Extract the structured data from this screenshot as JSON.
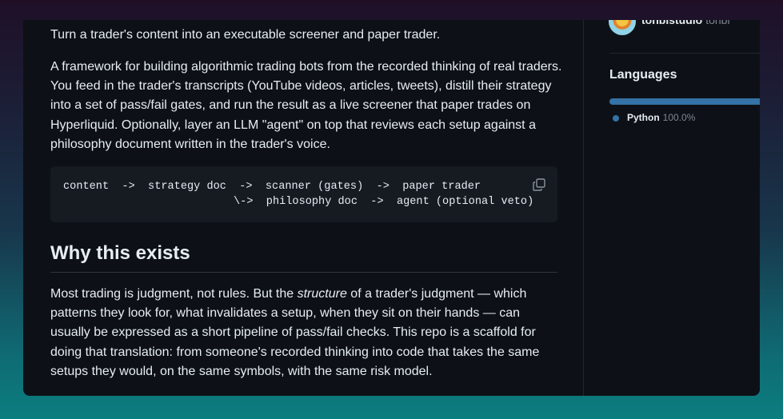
{
  "readme": {
    "tagline": "Turn a trader's content into an executable screener and paper trader.",
    "intro": "A framework for building algorithmic trading bots from the recorded thinking of real traders. You feed in the trader's transcripts (YouTube videos, articles, tweets), distill their strategy into a set of pass/fail gates, and run the result as a live screener that paper trades on Hyperliquid. Optionally, layer an LLM \"agent\" on top that reviews each setup against a philosophy document written in the trader's voice.",
    "code": {
      "line1": "content  ->  strategy doc  ->  scanner (gates)  ->  paper trader",
      "line2": "\\->  philosophy doc  ->  agent (optional veto)",
      "copy_icon": "copy-icon"
    },
    "section_heading": "Why this exists",
    "body": {
      "before": "Most trading is judgment, not rules. But the ",
      "emphasis": "structure",
      "after": " of a trader's judgment — which patterns they look for, what invalidates a setup, when they sit on their hands — can usually be expressed as a short pipeline of pass/fail checks. This repo is a scaffold for doing that translation: from someone's recorded thinking into code that takes the same setups they would, on the same symbols, with the same risk model."
    }
  },
  "sidebar": {
    "owner_name": "tonbistudio",
    "owner_handle": "tonbi",
    "languages_title": "Languages",
    "languages": [
      {
        "name": "Python",
        "percent": "100.0%",
        "color": "#3572a5"
      }
    ]
  }
}
